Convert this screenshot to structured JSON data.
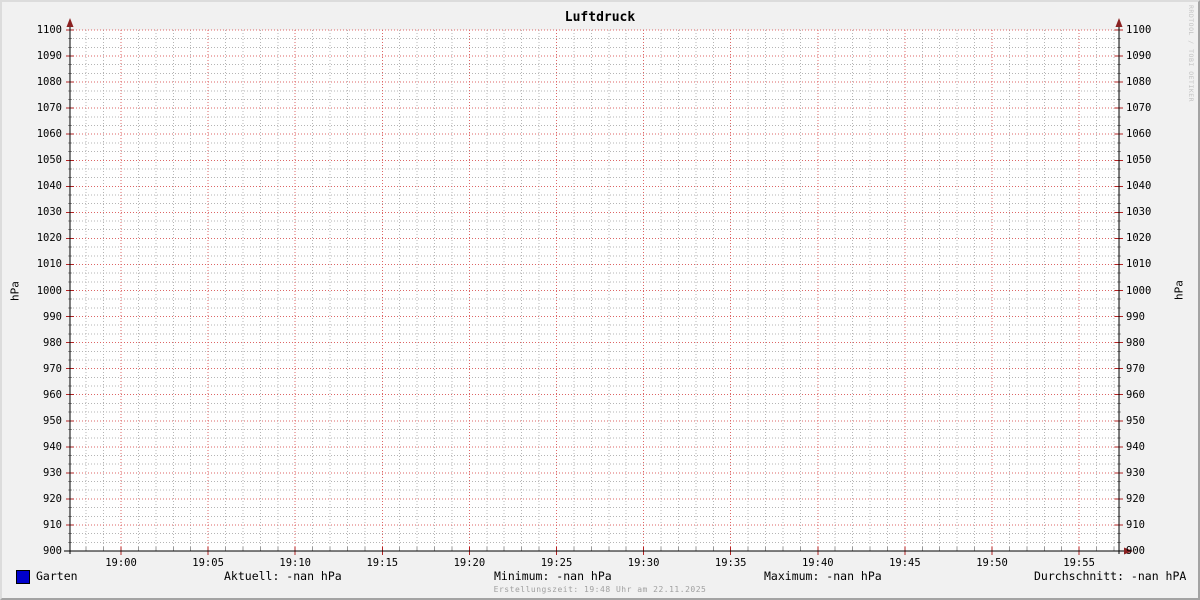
{
  "title": "Luftdruck",
  "watermark": "RRDTOOL / TOBI OETIKER",
  "axes": {
    "y_unit_left": "hPa",
    "y_unit_right": "hPa",
    "y_ticks": [
      "1100",
      "1090",
      "1080",
      "1070",
      "1060",
      "1050",
      "1040",
      "1030",
      "1020",
      "1010",
      "1000",
      "990",
      "980",
      "970",
      "960",
      "950",
      "940",
      "930",
      "920",
      "910",
      "900"
    ],
    "x_ticks": [
      "19:00",
      "19:05",
      "19:10",
      "19:15",
      "19:20",
      "19:25",
      "19:30",
      "19:35",
      "19:40",
      "19:45",
      "19:50",
      "19:55"
    ]
  },
  "legend": {
    "label": "Garten",
    "color": "#0000cc"
  },
  "stats": [
    {
      "text": "Aktuell: -nan hPa"
    },
    {
      "text": "Minimum: -nan hPa"
    },
    {
      "text": "Maximum: -nan hPa"
    },
    {
      "text": "Durchschnitt: -nan hPA"
    }
  ],
  "footer": {
    "created": "Erstellungszeit: 19:48 Uhr am 22.11.2025"
  },
  "chart_data": {
    "type": "line",
    "title": "Luftdruck",
    "xlabel": "",
    "ylabel": "hPa",
    "ylim": [
      900,
      1100
    ],
    "y_tick_step": 10,
    "x": [
      "19:00",
      "19:05",
      "19:10",
      "19:15",
      "19:20",
      "19:25",
      "19:30",
      "19:35",
      "19:40",
      "19:45",
      "19:50",
      "19:55"
    ],
    "series": [
      {
        "name": "Garten",
        "color": "#0000cc",
        "values": []
      }
    ],
    "stats": {
      "aktuell": "-nan hPa",
      "minimum": "-nan hPa",
      "maximum": "-nan hPa",
      "durchschnitt": "-nan hPA"
    },
    "grid": "on",
    "grid_major_color": "#dd6666",
    "grid_minor_color": "#b5b5b5",
    "axis_arrow_color": "#8b2222",
    "legend_position": "bottom",
    "note": "no data plotted (all values -nan)"
  }
}
